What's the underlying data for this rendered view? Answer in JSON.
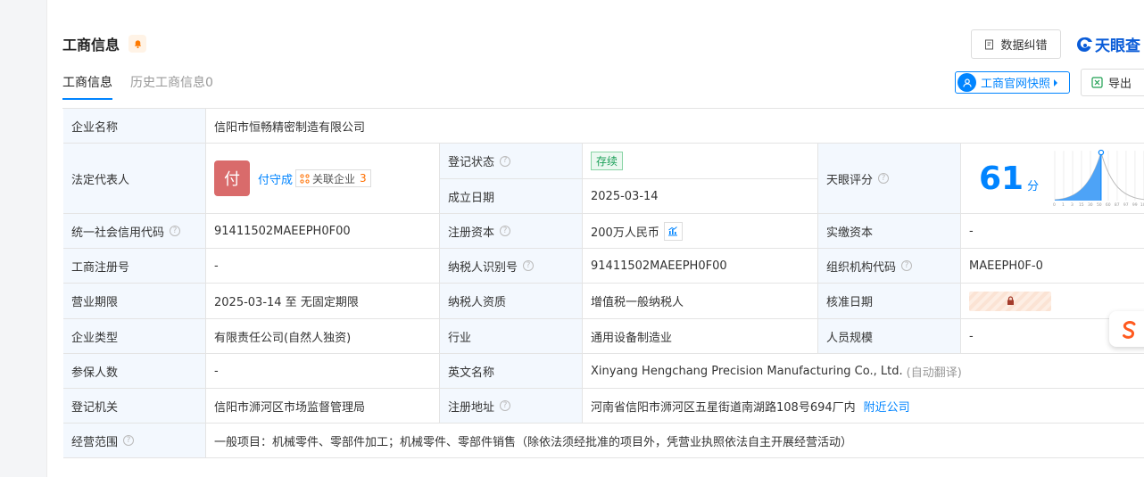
{
  "header": {
    "title": "工商信息",
    "correct_btn": "数据纠错",
    "logo_text": "天眼查"
  },
  "tabs": [
    {
      "label": "工商信息"
    },
    {
      "label": "历史工商信息0"
    }
  ],
  "actions": {
    "snapshot_btn": "工商官网快照",
    "export_btn": "导出"
  },
  "rows": {
    "company_name_label": "企业名称",
    "company_name": "信阳市恒畅精密制造有限公司",
    "legal_rep_label": "法定代表人",
    "legal_rep_avatar": "付",
    "legal_rep_name": "付守成",
    "assoc_label": "关联企业",
    "assoc_count": "3",
    "reg_status_label": "登记状态",
    "reg_status": "存续",
    "found_date_label": "成立日期",
    "found_date": "2025-03-14",
    "score_label": "天眼评分",
    "score": "61",
    "score_unit": "分",
    "credit_code_label": "统一社会信用代码",
    "credit_code": "91411502MAEEPH0F00",
    "reg_capital_label": "注册资本",
    "reg_capital": "200万人民币",
    "paid_capital_label": "实缴资本",
    "paid_capital": "-",
    "reg_no_label": "工商注册号",
    "reg_no": "-",
    "taxpayer_id_label": "纳税人识别号",
    "taxpayer_id": "91411502MAEEPH0F00",
    "org_code_label": "组织机构代码",
    "org_code": "MAEEPH0F-0",
    "term_label": "营业期限",
    "term": "2025-03-14 至 无固定期限",
    "taxpayer_qual_label": "纳税人资质",
    "taxpayer_qual": "增值税一般纳税人",
    "approve_date_label": "核准日期",
    "type_label": "企业类型",
    "type": "有限责任公司(自然人独资)",
    "industry_label": "行业",
    "industry": "通用设备制造业",
    "staff_label": "人员规模",
    "staff": "-",
    "insured_label": "参保人数",
    "insured": "-",
    "eng_name_label": "英文名称",
    "eng_name": "Xinyang Hengchang Precision Manufacturing Co., Ltd.",
    "eng_name_note": "(自动翻译)",
    "authority_label": "登记机关",
    "authority": "信阳市浉河区市场监督管理局",
    "address_label": "注册地址",
    "address": "河南省信阳市浉河区五星街道南湖路108号694厂内",
    "nearby_link": "附近公司",
    "scope_label": "经营范围",
    "scope": "一般项目：机械零件、零部件加工；机械零件、零部件销售（除依法须经批准的项目外，凭营业执照依法自主开展经营活动）"
  },
  "chart_data": {
    "type": "area",
    "x_ticks": [
      "0",
      "1",
      "3",
      "15",
      "30",
      "50",
      "60",
      "87",
      "97",
      "99",
      "100"
    ],
    "marker_label": "61"
  },
  "colors": {
    "accent": "#0084ff",
    "label_bg": "#f3f8fe",
    "status_green": "#1ca059",
    "avatar": "#d96b6b"
  }
}
